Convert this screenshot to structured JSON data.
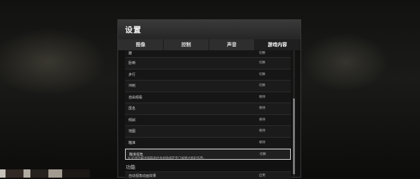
{
  "dialog": {
    "title": "设置",
    "tabs": [
      {
        "label": "图像",
        "active": false
      },
      {
        "label": "控制",
        "active": false
      },
      {
        "label": "声音",
        "active": false
      },
      {
        "label": "游戏内容",
        "active": true
      }
    ],
    "rows": [
      {
        "label": "蹲",
        "value": "切换"
      },
      {
        "label": "卧倒",
        "value": "切换"
      },
      {
        "label": "步行",
        "value": "切换"
      },
      {
        "label": "冲刺",
        "value": "切换"
      },
      {
        "label": "自由观看",
        "value": "保持"
      },
      {
        "label": "屏息",
        "value": "保持"
      },
      {
        "label": "倾斜",
        "value": "保持"
      },
      {
        "label": "地图",
        "value": "保持"
      },
      {
        "label": "瞄准",
        "value": "保持"
      },
      {
        "label": "瞄准视角",
        "value": "切换"
      }
    ],
    "note": "※ 必须为瞄准和瞄准时会视角绑定专门按键才能起作用。",
    "section": "功能",
    "bottom_row": {
      "label": "自动视角动画效果",
      "value": "启用"
    }
  }
}
